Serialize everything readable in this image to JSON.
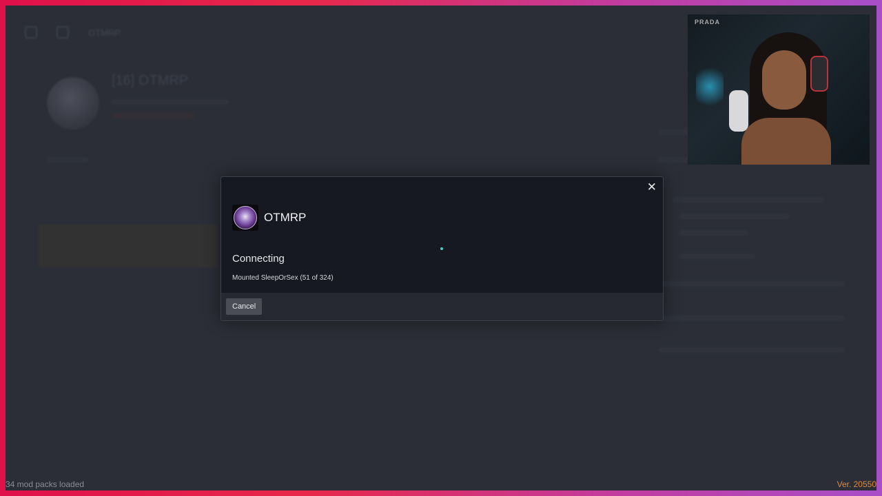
{
  "background": {
    "topbar_title": "OTMRP",
    "server_title": "[16] OTMRP"
  },
  "footer": {
    "mod_packs": "34 mod packs loaded",
    "version": "Ver. 20550"
  },
  "webcam": {
    "sign_text": "PRADA"
  },
  "modal": {
    "close_icon": "close-icon",
    "server_name": "OTMRP",
    "status_title": "Connecting",
    "status_detail": "Mounted SleepOrSex (51 of 324)",
    "cancel_label": "Cancel",
    "spinner_color": "#37d6c8"
  }
}
